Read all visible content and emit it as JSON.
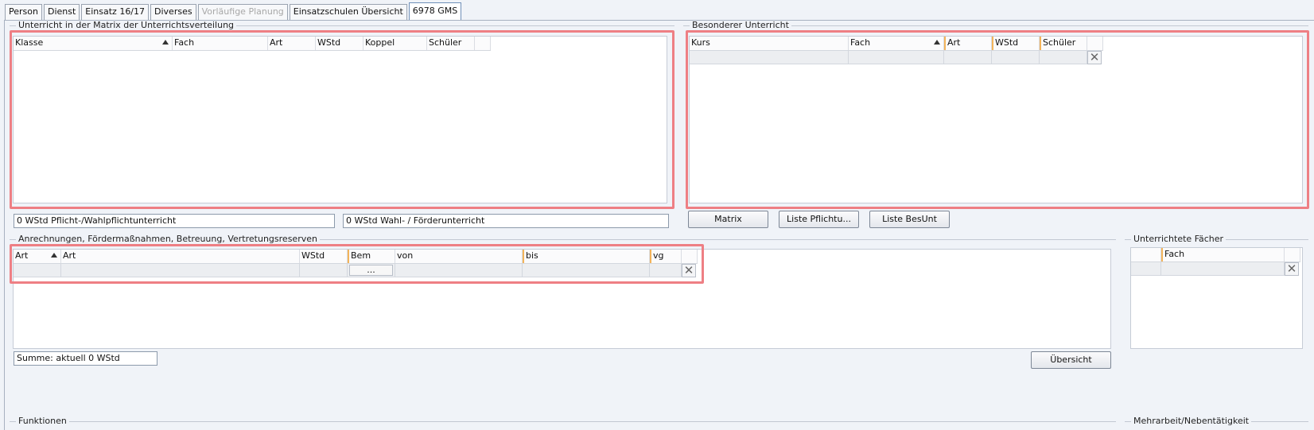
{
  "tabs": [
    {
      "label": "Person",
      "state": "normal"
    },
    {
      "label": "Dienst",
      "state": "normal"
    },
    {
      "label": "Einsatz 16/17",
      "state": "normal"
    },
    {
      "label": "Diverses",
      "state": "normal"
    },
    {
      "label": "Vorläufige Planung",
      "state": "disabled"
    },
    {
      "label": "Einsatzschulen Übersicht",
      "state": "normal"
    },
    {
      "label": "6978 GMS",
      "state": "active"
    }
  ],
  "unterricht": {
    "title": "Unterricht in der Matrix der Unterrichtsverteilung",
    "columns": [
      "Klasse",
      "Fach",
      "Art",
      "WStd",
      "Koppel",
      "Schüler"
    ],
    "sort_column": "Klasse",
    "pflicht_text": "0 WStd Pflicht-/Wahlpflichtunterricht",
    "wahl_text": "0 WStd Wahl- / Förderunterricht"
  },
  "besonderer": {
    "title": "Besonderer Unterricht",
    "columns": [
      "Kurs",
      "Fach",
      "Art",
      "WStd",
      "Schüler"
    ],
    "sort_column": "Fach",
    "buttons": {
      "matrix": "Matrix",
      "pflicht": "Liste Pflichtu...",
      "besunt": "Liste BesUnt"
    }
  },
  "anrechnungen": {
    "title": "Anrechnungen, Fördermaßnahmen, Betreuung, Vertretungsreserven",
    "columns": [
      "Art",
      "Art",
      "WStd",
      "Bem",
      "von",
      "bis",
      "vg"
    ],
    "sort_column": "Art",
    "bem_button": "...",
    "summe": "Summe: aktuell 0 WStd",
    "uebersicht_button": "Übersicht"
  },
  "faecher": {
    "title": "Unterrichtete Fächer",
    "columns": [
      "Fach"
    ]
  },
  "funktionen": {
    "title": "Funktionen"
  },
  "mehrarbeit": {
    "title": "Mehrarbeit/Nebentätigkeit"
  },
  "colors": {
    "highlight": "#ee7f84",
    "sort_marker": "#f3b45a",
    "background": "#f0f3f8"
  }
}
